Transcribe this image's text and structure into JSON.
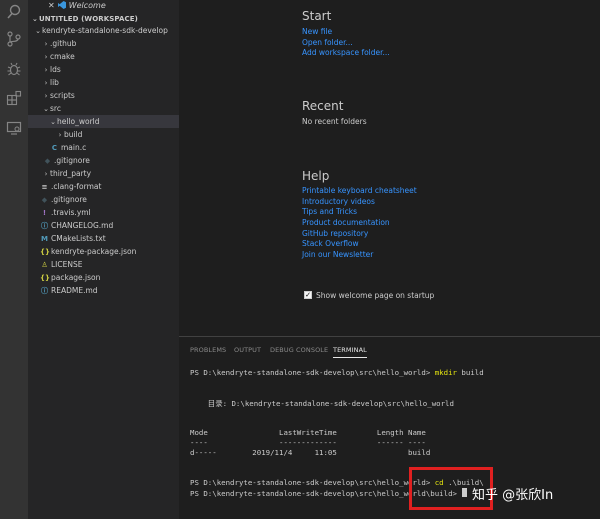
{
  "tab": {
    "label": "Welcome"
  },
  "explorer": {
    "header": "UNTITLED (WORKSPACE)",
    "items": [
      {
        "label": "kendryte-standalone-sdk-develop",
        "chevron": "⌄"
      },
      {
        "label": ".github",
        "chevron": "›"
      },
      {
        "label": "cmake",
        "chevron": "›"
      },
      {
        "label": "lds",
        "chevron": "›"
      },
      {
        "label": "lib",
        "chevron": "›"
      },
      {
        "label": "scripts",
        "chevron": "›"
      },
      {
        "label": "src",
        "chevron": "⌄"
      },
      {
        "label": "hello_world",
        "chevron": "⌄"
      },
      {
        "label": "build",
        "chevron": "›"
      },
      {
        "label": "main.c",
        "icon": "C"
      },
      {
        "label": ".gitignore",
        "icon": "◆"
      },
      {
        "label": "third_party",
        "chevron": "›"
      },
      {
        "label": ".clang-format",
        "icon": "≡"
      },
      {
        "label": ".gitignore",
        "icon": "◆"
      },
      {
        "label": ".travis.yml",
        "icon": "!"
      },
      {
        "label": "CHANGELOG.md",
        "icon": "ⓘ"
      },
      {
        "label": "CMakeLists.txt",
        "icon": "M"
      },
      {
        "label": "kendryte-package.json",
        "icon": "{}"
      },
      {
        "label": "LICENSE",
        "icon": "♙"
      },
      {
        "label": "package.json",
        "icon": "{}"
      },
      {
        "label": "README.md",
        "icon": "ⓘ"
      }
    ]
  },
  "welcome": {
    "start_title": "Start",
    "start_links": [
      "New file",
      "Open folder...",
      "Add workspace folder..."
    ],
    "recent_title": "Recent",
    "recent_empty": "No recent folders",
    "help_title": "Help",
    "help_links": [
      "Printable keyboard cheatsheet",
      "Introductory videos",
      "Tips and Tricks",
      "Product documentation",
      "GitHub repository",
      "Stack Overflow",
      "Join our Newsletter"
    ],
    "startup_checkbox_label": "Show welcome page on startup"
  },
  "panel": {
    "tabs": [
      "PROBLEMS",
      "OUTPUT",
      "DEBUG CONSOLE",
      "TERMINAL"
    ],
    "active_tab": "TERMINAL",
    "terminal": {
      "prompt1": "PS D:\\kendryte-standalone-sdk-develop\\src\\hello_world> ",
      "cmd1": "mkdir",
      "arg1": " build",
      "dir_line": "    目录: D:\\kendryte-standalone-sdk-develop\\src\\hello_world",
      "header_line": "Mode                LastWriteTime         Length Name",
      "sep_line": "----                -------------         ------ ----",
      "entry_line": "d-----        2019/11/4     11:05                build",
      "prompt2": "PS D:\\kendryte-standalone-sdk-develop\\src\\hello_world> ",
      "cmd2": "cd",
      "arg2": " .\\build\\",
      "prompt3": "PS D:\\kendryte-standalone-sdk-develop\\src\\hello_world\\build> "
    }
  },
  "watermark": "知乎 @张欣In",
  "colors": {
    "activity_bar": "#333333",
    "sidebar": "#252526",
    "editor": "#1e1e1e",
    "link": "#3794ff",
    "highlight": "#e02020"
  }
}
